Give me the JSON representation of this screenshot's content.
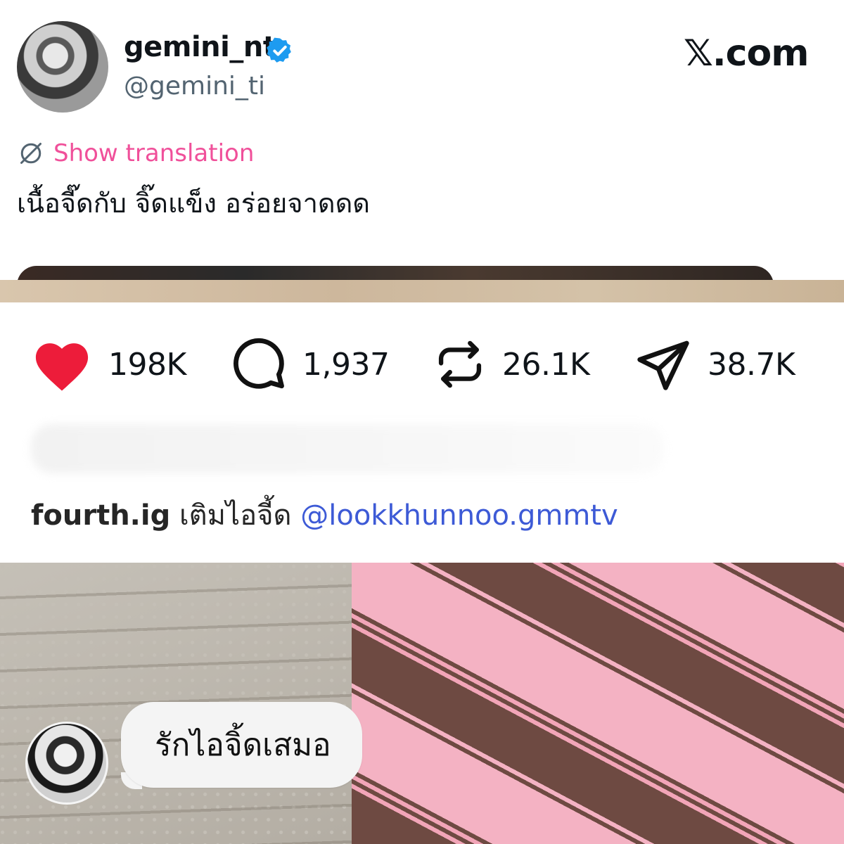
{
  "post": {
    "display_name": "gemini_nt",
    "handle": "@gemini_ti",
    "verified": true,
    "platform_logo": "𝕏.com",
    "translate_label": "Show translation",
    "text": "เนื้อจี๊ดกับ จิ๊ดแข็ง อร่อยจาดดด",
    "icons": {
      "verified": "verified-badge-icon",
      "translate": "globe-slash-icon"
    },
    "colors": {
      "translate_link": "#f0509a",
      "verified": "#1d9bf0",
      "handle": "#536471"
    }
  },
  "engagement": {
    "likes": "198K",
    "comments": "1,937",
    "reposts": "26.1K",
    "shares": "38.7K",
    "icons": [
      "heart-icon",
      "comment-icon",
      "repost-icon",
      "send-icon"
    ],
    "colors": {
      "heart": "#ed1c3a"
    }
  },
  "caption": {
    "username": "fourth.ig",
    "text": "เติมไอจี้ด",
    "mention": "@lookkhunnoo.gmmtv",
    "colors": {
      "mention": "#3d5ad6"
    }
  },
  "story_reply": {
    "message": "รักไอจิ้ดเสมอ"
  }
}
